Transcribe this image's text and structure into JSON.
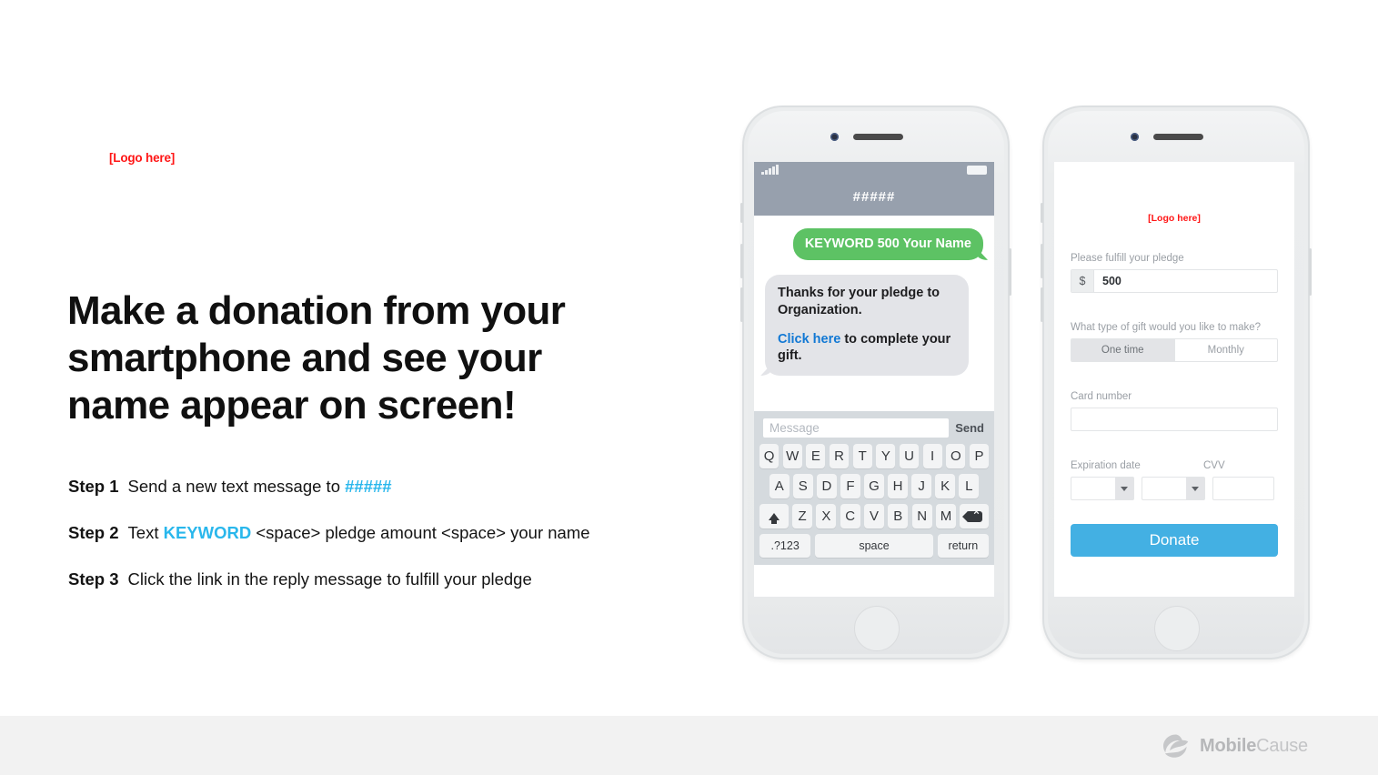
{
  "slide": {
    "logo_placeholder": "[Logo here]",
    "headline": "Make a donation from your smartphone and see your name appear on screen!",
    "steps": [
      {
        "label": "Step 1",
        "pre": "Send a new text message to ",
        "highlight": "#####",
        "post": ""
      },
      {
        "label": "Step 2",
        "pre": "Text ",
        "highlight": "KEYWORD",
        "post": " <space> pledge amount <space> your name"
      },
      {
        "label": "Step 3",
        "pre": "Click the link in the reply message to fulfill your pledge",
        "highlight": "",
        "post": ""
      }
    ]
  },
  "phone_messages": {
    "status_bar": {
      "signal_icon": "signal-bars-icon",
      "battery_icon": "battery-icon"
    },
    "nav_title": "#####",
    "outgoing_message": "KEYWORD 500 Your Name",
    "incoming_message_line1": "Thanks for your pledge to",
    "incoming_message_line2": "Organization.",
    "incoming_link": "Click here",
    "incoming_after_link": " to complete your gift.",
    "input_placeholder": "Message",
    "send_label": "Send",
    "keyboard": {
      "row1": [
        "Q",
        "W",
        "E",
        "R",
        "T",
        "Y",
        "U",
        "I",
        "O",
        "P"
      ],
      "row2": [
        "A",
        "S",
        "D",
        "F",
        "G",
        "H",
        "J",
        "K",
        "L"
      ],
      "row3_shift": "shift-icon",
      "row3": [
        "Z",
        "X",
        "C",
        "V",
        "B",
        "N",
        "M"
      ],
      "row3_delete": "backspace-icon",
      "numeric_key": ".?123",
      "space_key": "space",
      "return_key": "return"
    }
  },
  "phone_donation": {
    "logo_placeholder": "[Logo here]",
    "pledge_label": "Please fulfill your pledge",
    "currency_symbol": "$",
    "pledge_amount": "500",
    "gift_type_label": "What type of gift would you like to make?",
    "gift_type_options": [
      "One time",
      "Monthly"
    ],
    "gift_type_selected": "One time",
    "card_number_label": "Card number",
    "card_number_value": "",
    "expiration_label": "Expiration date",
    "expiration_month": "",
    "expiration_year": "",
    "cvv_label": "CVV",
    "cvv_value": "",
    "donate_button": "Donate"
  },
  "footer": {
    "brand_bold": "Mobile",
    "brand_light": "Cause",
    "brand_icon": "mobilecause-swirl-icon"
  },
  "colors": {
    "accent_cyan": "#29b7ec",
    "donate_blue": "#43b0e3",
    "bubble_green": "#5dc264",
    "bubble_gray": "#e3e4e8",
    "logo_red": "#ff1616",
    "navbar_gray": "#97a0ad",
    "footer_gray": "#f2f2f2"
  }
}
